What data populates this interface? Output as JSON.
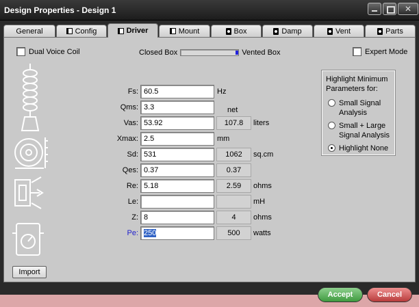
{
  "window": {
    "title": "Design Properties - Design 1"
  },
  "tabs": [
    {
      "label": "General",
      "icon": ""
    },
    {
      "label": "Config",
      "icon": "speaker-icon"
    },
    {
      "label": "Driver",
      "icon": "speaker-icon",
      "active": true
    },
    {
      "label": "Mount",
      "icon": "speaker-icon"
    },
    {
      "label": "Box",
      "icon": "box-icon"
    },
    {
      "label": "Damp",
      "icon": "box-icon"
    },
    {
      "label": "Vent",
      "icon": "box-icon"
    },
    {
      "label": "Parts",
      "icon": "box-icon"
    }
  ],
  "options": {
    "dual_voice_coil": {
      "label": "Dual Voice Coil",
      "checked": false
    },
    "expert_mode": {
      "label": "Expert Mode",
      "checked": false
    }
  },
  "box_type": {
    "left_label": "Closed Box",
    "right_label": "Vented Box",
    "value": 1.0
  },
  "params": [
    {
      "label": "Fs:",
      "value": "60.5",
      "derived": "",
      "unit": "Hz",
      "derived_shown": false
    },
    {
      "label": "Qms:",
      "value": "3.3",
      "derived": "",
      "unit": "net",
      "derived_shown": false
    },
    {
      "label": "Vas:",
      "value": "53.92",
      "derived": "107.8",
      "unit": "liters",
      "derived_shown": true
    },
    {
      "label": "Xmax:",
      "value": "2.5",
      "derived": "",
      "unit": "mm",
      "derived_shown": false
    },
    {
      "label": "Sd:",
      "value": "531",
      "derived": "1062",
      "unit": "sq.cm",
      "derived_shown": true
    },
    {
      "label": "Qes:",
      "value": "0.37",
      "derived": "0.37",
      "unit": "",
      "derived_shown": true
    },
    {
      "label": "Re:",
      "value": "5.18",
      "derived": "2.59",
      "unit": "ohms",
      "derived_shown": true
    },
    {
      "label": "Le:",
      "value": "",
      "derived": "",
      "unit": "mH",
      "derived_shown": true
    },
    {
      "label": "Z:",
      "value": "8",
      "derived": "4",
      "unit": "ohms",
      "derived_shown": true
    },
    {
      "label": "Pe:",
      "value": "250",
      "derived": "500",
      "unit": "watts",
      "derived_shown": true,
      "selected": true
    }
  ],
  "highlight": {
    "title": "Highlight Minimum Parameters for:",
    "options": [
      {
        "label": "Small Signal Analysis",
        "selected": false
      },
      {
        "label": "Small + Large Signal Analysis",
        "selected": false
      },
      {
        "label": "Highlight None",
        "selected": true
      }
    ]
  },
  "buttons": {
    "import": "Import",
    "accept": "Accept",
    "cancel": "Cancel"
  },
  "colors": {
    "selected_label": "#2222cc",
    "selection_bg": "#3163c5",
    "accept": "#4fa84f",
    "cancel": "#c44a4a"
  }
}
